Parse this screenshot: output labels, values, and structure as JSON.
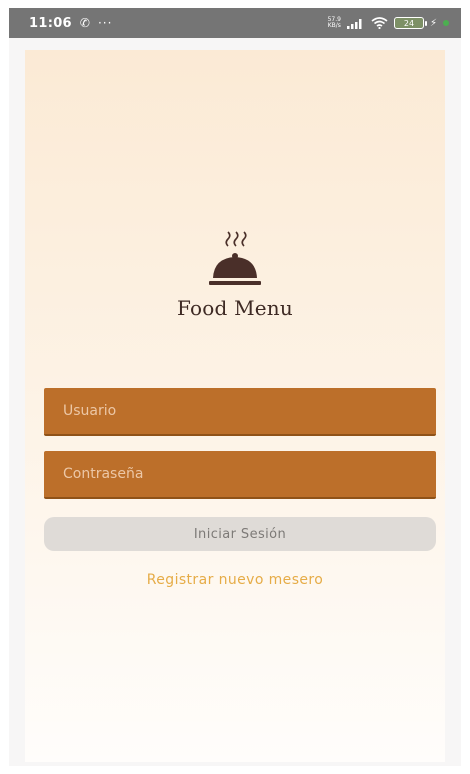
{
  "status_bar": {
    "time": "11:06",
    "call_icon_glyph": "✆",
    "overflow_glyph": "···",
    "net_speed_value": "57.9",
    "net_speed_unit": "KB/s",
    "battery_level": "24",
    "charging_glyph": "⚡",
    "icons": [
      "call-icon",
      "signal-icon",
      "wifi-icon",
      "battery-icon",
      "charging-icon"
    ]
  },
  "app": {
    "title": "Food Menu",
    "logo_icon": "cloche-icon"
  },
  "form": {
    "username_placeholder": "Usuario",
    "password_placeholder": "Contraseña",
    "login_label": "Iniciar Sesión",
    "register_label": "Registrar nuevo mesero"
  },
  "colors": {
    "input_bg": "#bc6f2a",
    "button_bg": "#dfdbd7",
    "link": "#e6ac47",
    "logo": "#4a2f29"
  }
}
